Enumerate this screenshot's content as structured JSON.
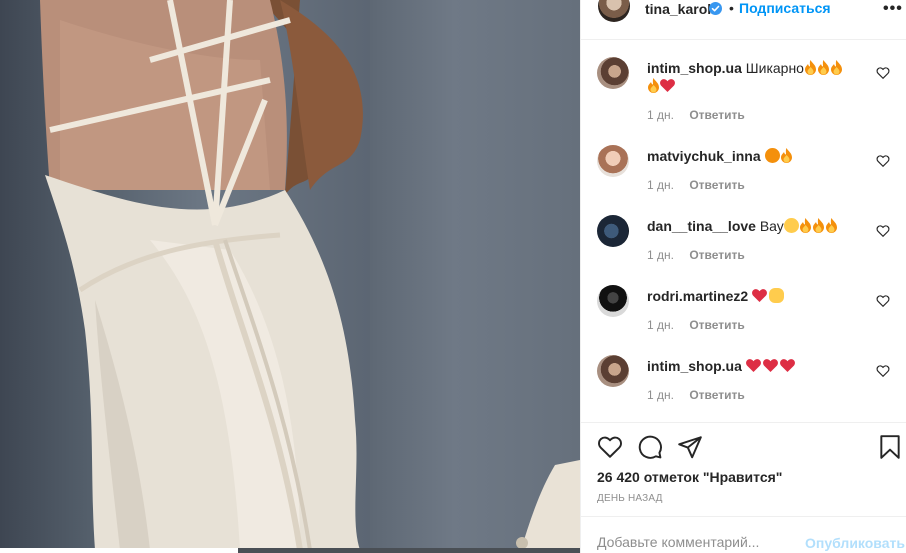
{
  "post": {
    "username": "tina_karol",
    "dot": "•",
    "follow_label": "Подписаться",
    "more_label": "•••"
  },
  "comments": [
    {
      "user": "intim_shop.ua",
      "text": "Шикарно",
      "emojis_line1": [
        "fire",
        "fire",
        "fire"
      ],
      "emojis_line2": [
        "fire",
        "heart"
      ],
      "time": "1 дн.",
      "reply": "Ответить"
    },
    {
      "user": "matviychuk_inna",
      "text": "",
      "emojis_line1": [
        "heart-eyes",
        "fire"
      ],
      "time": "1 дн.",
      "reply": "Ответить"
    },
    {
      "user": "dan__tina__love",
      "text": "Вау",
      "emojis_line1": [
        "smile",
        "fire",
        "fire",
        "fire"
      ],
      "time": "1 дн.",
      "reply": "Ответить"
    },
    {
      "user": "rodri.martinez2",
      "text": "",
      "emojis_line1": [
        "heart",
        "clap"
      ],
      "time": "1 дн.",
      "reply": "Ответить"
    },
    {
      "user": "intim_shop.ua",
      "text": "",
      "emojis_line1": [
        "heart",
        "heart",
        "heart"
      ],
      "time": "1 дн.",
      "reply": "Ответить"
    }
  ],
  "actions": {
    "likes": "26 420 отметок \"Нравится\"",
    "time": "ДЕНЬ НАЗАД"
  },
  "composer": {
    "placeholder": "Добавьте комментарий...",
    "publish_label": "Опубликовать"
  },
  "colors": {
    "accent": "#0095f6",
    "publish_disabled": "#b2dffc",
    "meta": "#8e8e8e",
    "heart": "#ed4956"
  }
}
